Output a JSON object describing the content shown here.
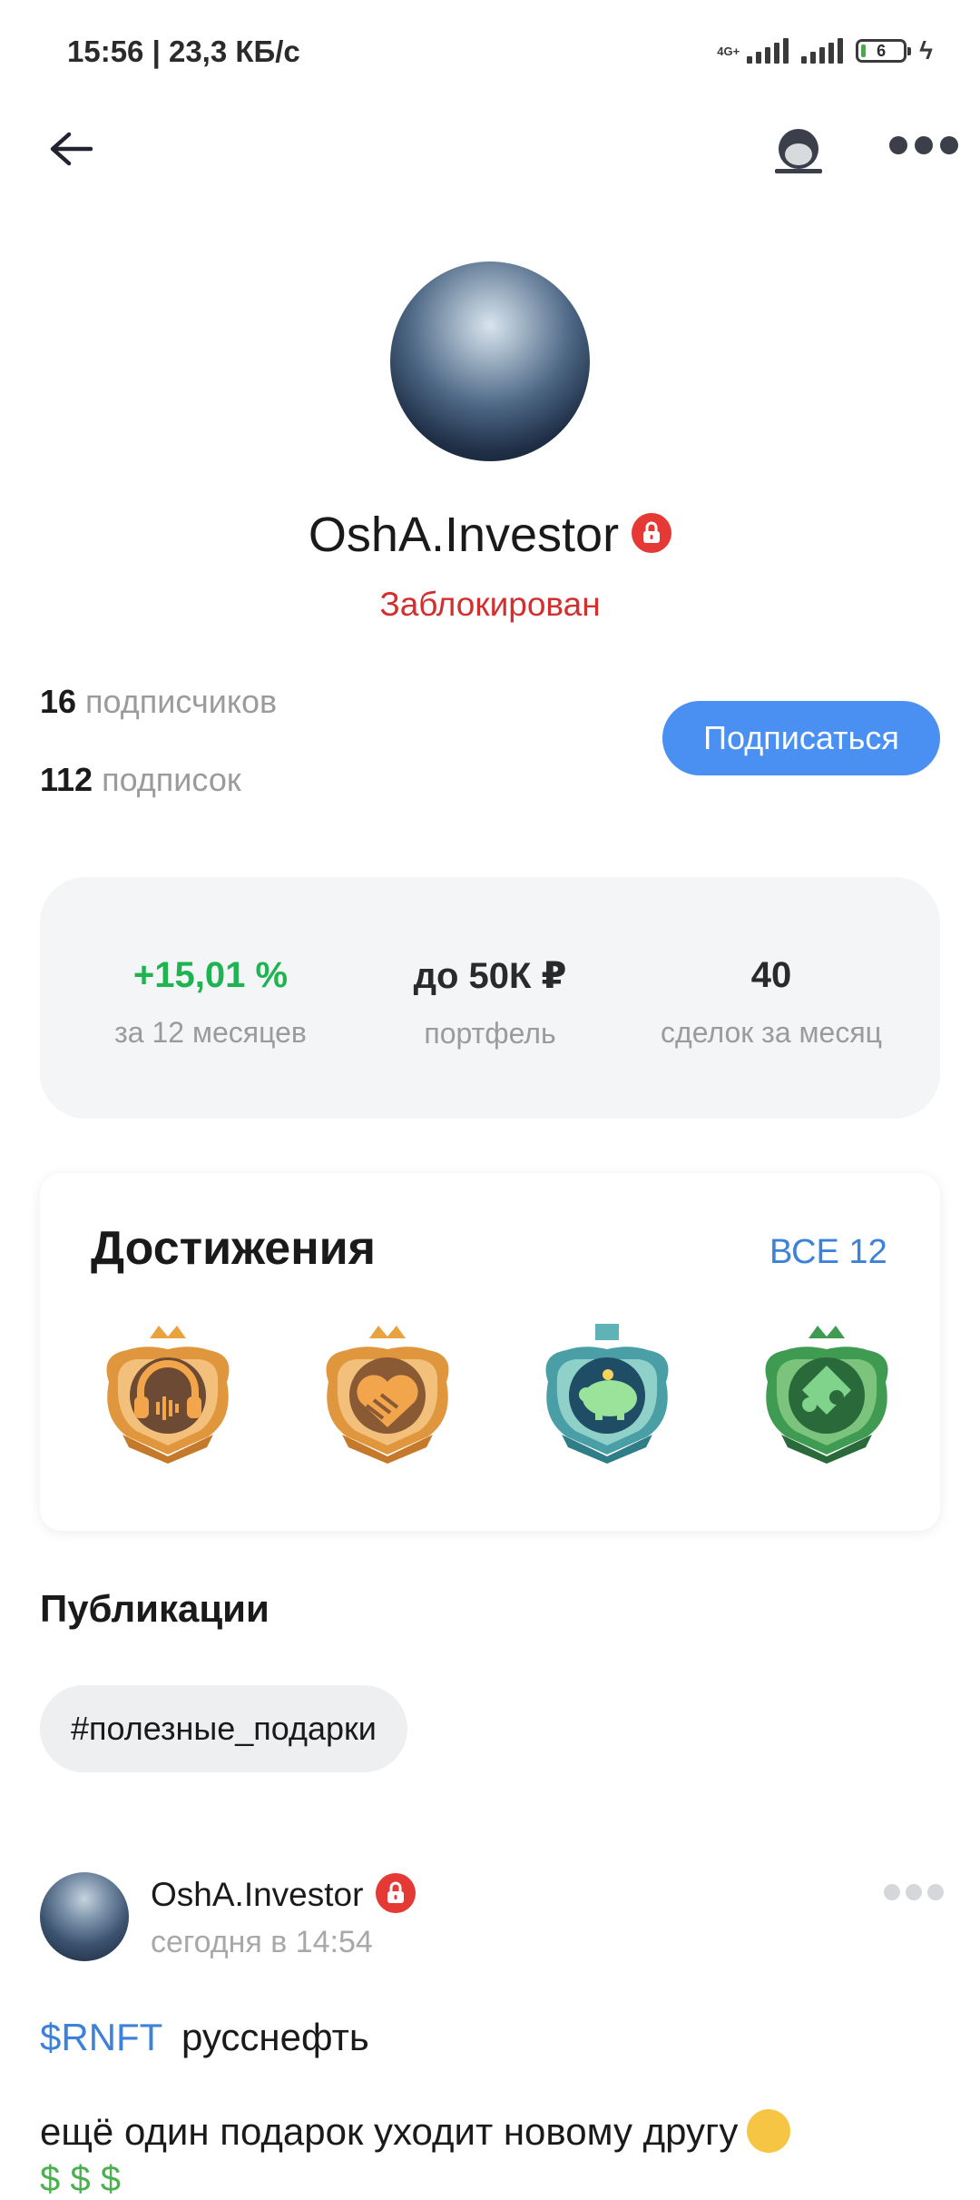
{
  "status_bar": {
    "time_speed": "15:56 | 23,3 КБ/с",
    "network_label": "4G+",
    "battery_level": "6",
    "icons": [
      "signal-icon",
      "signal-icon",
      "battery-icon",
      "charging-icon"
    ]
  },
  "nav": {
    "icons": [
      "back-arrow-icon",
      "share-icon",
      "more-icon"
    ]
  },
  "profile": {
    "name": "OshA.Investor",
    "status": "Заблокирован",
    "followers_count": "16",
    "followers_label": "подписчиков",
    "following_count": "112",
    "following_label": "подписок",
    "subscribe_label": "Подписаться"
  },
  "stats": [
    {
      "value": "+15,01 %",
      "label": "за 12 месяцев",
      "color": "#1fb352"
    },
    {
      "value": "до 50К ₽",
      "label": "портфель"
    },
    {
      "value": "40",
      "label": "сделок за месяц"
    }
  ],
  "achievements": {
    "title": "Достижения",
    "all_label": "ВСЕ 12",
    "badges": [
      {
        "icon": "audio-badge-icon",
        "color": "#e0963c"
      },
      {
        "icon": "handshake-badge-icon",
        "color": "#e0963c"
      },
      {
        "icon": "piggy-bank-badge-icon",
        "color": "#5fb2b6"
      },
      {
        "icon": "puzzle-badge-icon",
        "color": "#3f9a52"
      }
    ]
  },
  "publications": {
    "title": "Публикации",
    "tag": "#полезные_подарки"
  },
  "post": {
    "author": "OshA.Investor",
    "time": "сегодня в 14:54",
    "ticker": "$RNFT",
    "company": "русснефть",
    "text": "ещё один подарок уходит новому другу",
    "second_line": "$ $ $"
  },
  "colors": {
    "accent": "#4a8ff2",
    "link": "#3d82d8",
    "blocked": "#d32f2f",
    "positive": "#1fb352"
  }
}
